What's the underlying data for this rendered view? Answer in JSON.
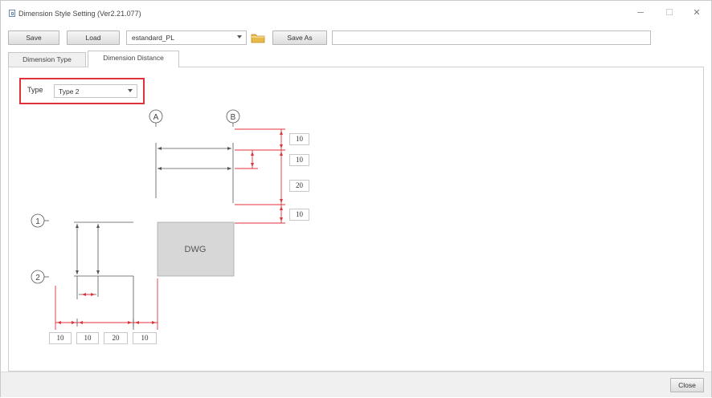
{
  "window": {
    "title": "Dimension Style Setting (Ver2.21.077)",
    "minimize": "─",
    "maximize": "☐",
    "close": "✕"
  },
  "toolbar": {
    "save_label": "Save",
    "load_label": "Load",
    "style_value": "estandard_PL",
    "save_as_label": "Save As",
    "save_as_value": ""
  },
  "tabs": [
    {
      "label": "Dimension Type"
    },
    {
      "label": "Dimension Distance"
    }
  ],
  "type_selector": {
    "label": "Type",
    "value": "Type 2"
  },
  "diagram": {
    "grid_labels": {
      "a": "A",
      "b": "B",
      "one": "1",
      "two": "2"
    },
    "center_block": "DWG",
    "right_fields": [
      "10",
      "10",
      "20",
      "10"
    ],
    "bottom_fields": [
      "10",
      "10",
      "20",
      "10"
    ]
  },
  "footer": {
    "close_label": "Close"
  },
  "colors": {
    "accent_red": "#e0323c",
    "dim_line": "#555555",
    "block_fill": "#d7d7d7"
  }
}
